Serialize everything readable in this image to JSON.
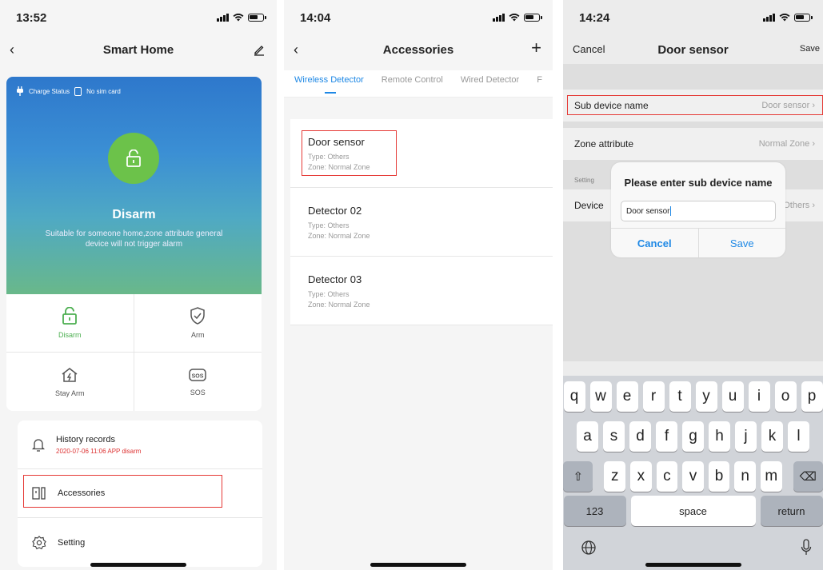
{
  "screen1": {
    "time": "13:52",
    "title": "Smart Home",
    "charge_status": "Charge Status",
    "sim_status": "No sim card",
    "mode_title": "Disarm",
    "mode_desc": "Suitable for someone home,zone attribute general device will not trigger alarm",
    "modes": [
      {
        "label": "Disarm",
        "icon": "unlock-icon",
        "active": true
      },
      {
        "label": "Arm",
        "icon": "shield-check-icon",
        "active": false
      },
      {
        "label": "Stay Arm",
        "icon": "home-bolt-icon",
        "active": false
      },
      {
        "label": "SOS",
        "icon": "sos-icon",
        "active": false
      }
    ],
    "menu": [
      {
        "label": "History records",
        "sub": "2020-07-06 11:06 APP disarm",
        "icon": "bell-icon"
      },
      {
        "label": "Accessories",
        "icon": "door-sensor-icon"
      },
      {
        "label": "Setting",
        "icon": "gear-icon"
      }
    ]
  },
  "screen2": {
    "time": "14:04",
    "title": "Accessories",
    "tabs": [
      "Wireless Detector",
      "Remote Control",
      "Wired Detector",
      "F"
    ],
    "devices": [
      {
        "name": "Door sensor",
        "type": "Type: Others",
        "zone": "Zone: Normal Zone"
      },
      {
        "name": "Detector 02",
        "type": "Type: Others",
        "zone": "Zone: Normal Zone"
      },
      {
        "name": "Detector 03",
        "type": "Type: Others",
        "zone": "Zone: Normal Zone"
      }
    ]
  },
  "screen3": {
    "time": "14:24",
    "title": "Door sensor",
    "cancel": "Cancel",
    "save": "Save",
    "sub_device_name_label": "Sub device name",
    "sub_device_name_value": "Door sensor",
    "zone_attribute_label": "Zone attribute",
    "zone_attribute_value": "Normal Zone",
    "setting_section": "Setting",
    "device_label": "Device",
    "device_value": "Others",
    "dialog": {
      "title": "Please enter sub device name",
      "input_value": "Door sensor",
      "cancel": "Cancel",
      "save": "Save"
    },
    "keyboard": {
      "row1": [
        "q",
        "w",
        "e",
        "r",
        "t",
        "y",
        "u",
        "i",
        "o",
        "p"
      ],
      "row2": [
        "a",
        "s",
        "d",
        "f",
        "g",
        "h",
        "j",
        "k",
        "l"
      ],
      "row3": [
        "z",
        "x",
        "c",
        "v",
        "b",
        "n",
        "m"
      ],
      "k123": "123",
      "space": "space",
      "return": "return"
    }
  }
}
